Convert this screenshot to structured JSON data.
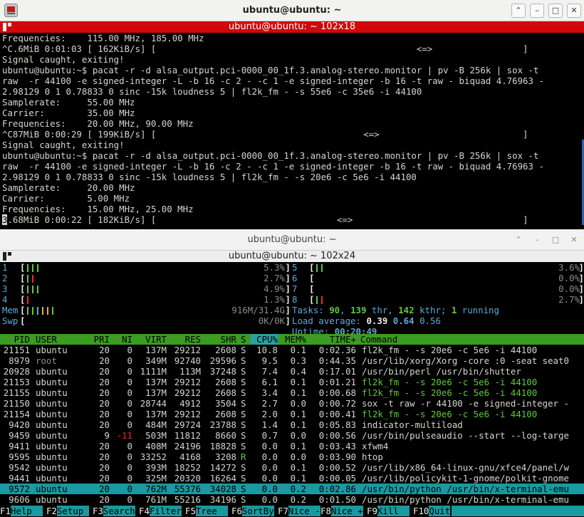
{
  "window1": {
    "title": "ubuntu@ubuntu: ~",
    "tab_title": "ubuntu@ubuntu: ~ 102x18",
    "buttons": {
      "up": "⌃",
      "minimize": "–",
      "maximize": "□",
      "close": "✕"
    },
    "lines": [
      "Frequencies:    115.00 MHz, 185.00 MHz",
      "^C.6MiB 0:01:03 [ 162KiB/s] [                                                 <=>                 ]",
      "Signal caught, exiting!",
      "ubuntu@ubuntu:~$ pacat -r -d alsa_output.pci-0000_00_1f.3.analog-stereo.monitor | pv -B 256k | sox -t",
      "raw  -r 44100 -e signed-integer -L -b 16 -c 2 - -c 1 -e signed-integer -b 16 -t raw - biquad 4.76963 -",
      "2.98129 0 1 0.78833 0 sinc -15k loudness 5 | fl2k_fm - -s 55e6 -c 35e6 -i 44100",
      "Samplerate:     55.00 MHz",
      "Carrier:        35.00 MHz",
      "Frequencies:    20.00 MHz, 90.00 MHz",
      "^C87MiB 0:00:29 [ 199KiB/s] [                                       <=>                           ]",
      "Signal caught, exiting!",
      "ubuntu@ubuntu:~$ pacat -r -d alsa_output.pci-0000_00_1f.3.analog-stereo.monitor | pv -B 256k | sox -t",
      "raw  -r 44100 -e signed-integer -L -b 16 -c 2 - -c 1 -e signed-integer -b 16 -t raw - biquad 4.76963 -",
      "2.98129 0 1 0.78833 0 sinc -15k loudness 5 | fl2k_fm - -s 20e6 -c 5e6 -i 44100",
      "Samplerate:     20.00 MHz",
      "Carrier:        5.00 MHz",
      "Frequencies:    15.00 MHz, 25.00 MHz"
    ],
    "last_line_cursor": "3",
    "last_line_rest": ".68MiB 0:00:22 [ 182KiB/s] [                                  <=>                                ]"
  },
  "window2": {
    "title": "ubuntu@ubuntu: ~",
    "tab_title": "ubuntu@ubuntu: ~ 102x24",
    "buttons": {
      "up": "⌃",
      "minimize": "–",
      "maximize": "□",
      "close": "✕"
    },
    "cpus_left": [
      {
        "label": "1",
        "value": "5.3%",
        "fill": 0.053
      },
      {
        "label": "2",
        "value": "2.7%",
        "fill": 0.027
      },
      {
        "label": "3",
        "value": "4.9%",
        "fill": 0.049
      },
      {
        "label": "4",
        "value": "1.3%",
        "fill": 0.013
      }
    ],
    "mem": {
      "label": "Mem",
      "value": "916M/31.4G"
    },
    "swp": {
      "label": "Swp",
      "value": "0K/0K"
    },
    "cpus_right": [
      {
        "label": "5",
        "value": "3.6%",
        "fill": 0.036
      },
      {
        "label": "6",
        "value": "0.0%",
        "fill": 0.0
      },
      {
        "label": "7",
        "value": "0.0%",
        "fill": 0.0
      },
      {
        "label": "8",
        "value": "2.7%",
        "fill": 0.027
      }
    ],
    "tasks": {
      "label": "Tasks: ",
      "count": "90",
      "sep1": ", ",
      "threads": "139",
      "thr_label": " thr, ",
      "kthreads": "142",
      "kthr_label": " kthr; ",
      "running": "1",
      "running_label": " running"
    },
    "load": {
      "label": "Load average: ",
      "l1": "0.39",
      "l5": "0.64",
      "l15": "0.56"
    },
    "uptime": {
      "label": "Uptime: ",
      "value": "00:20:49"
    },
    "columns": {
      "pid": "PID",
      "user": "USER",
      "pri": "PRI",
      "ni": "NI",
      "virt": "VIRT",
      "res": "RES",
      "shr": "SHR",
      "s": "S",
      "cpu": "CPU%",
      "mem": "MEM%",
      "time": "TIME+",
      "cmd": "Command"
    },
    "processes": [
      {
        "pid": "21151",
        "user": "ubuntu",
        "pri": "20",
        "ni": "0",
        "virt": "137M",
        "res": "29212",
        "shr": "2608",
        "s": "S",
        "cpu": "10.8",
        "mem": "0.1",
        "time": "0:02.36",
        "cmd": "fl2k_fm - -s 20e6 -c 5e6 -i 44100",
        "style": ""
      },
      {
        "pid": "8979",
        "user": "root",
        "pri": "20",
        "ni": "0",
        "virt": "349M",
        "res": "92740",
        "shr": "29596",
        "s": "S",
        "cpu": "9.5",
        "mem": "0.3",
        "time": "0:44.35",
        "cmd": "/usr/lib/xorg/Xorg -core :0 -seat seat0",
        "style": "root"
      },
      {
        "pid": "20928",
        "user": "ubuntu",
        "pri": "20",
        "ni": "0",
        "virt": "1111M",
        "res": "113M",
        "shr": "37248",
        "s": "S",
        "cpu": "7.4",
        "mem": "0.4",
        "time": "0:17.01",
        "cmd": "/usr/bin/perl /usr/bin/shutter",
        "style": ""
      },
      {
        "pid": "21153",
        "user": "ubuntu",
        "pri": "20",
        "ni": "0",
        "virt": "137M",
        "res": "29212",
        "shr": "2608",
        "s": "S",
        "cpu": "6.1",
        "mem": "0.1",
        "time": "0:01.21",
        "cmd": "fl2k_fm - -s 20e6 -c 5e6 -i 44100",
        "style": "thread"
      },
      {
        "pid": "21155",
        "user": "ubuntu",
        "pri": "20",
        "ni": "0",
        "virt": "137M",
        "res": "29212",
        "shr": "2608",
        "s": "S",
        "cpu": "3.4",
        "mem": "0.1",
        "time": "0:00.68",
        "cmd": "fl2k_fm - -s 20e6 -c 5e6 -i 44100",
        "style": "thread"
      },
      {
        "pid": "21150",
        "user": "ubuntu",
        "pri": "20",
        "ni": "0",
        "virt": "28744",
        "res": "4912",
        "shr": "3504",
        "s": "S",
        "cpu": "2.7",
        "mem": "0.0",
        "time": "0:00.72",
        "cmd": "sox -t raw -r 44100 -e signed-integer -",
        "style": ""
      },
      {
        "pid": "21154",
        "user": "ubuntu",
        "pri": "20",
        "ni": "0",
        "virt": "137M",
        "res": "29212",
        "shr": "2608",
        "s": "S",
        "cpu": "2.0",
        "mem": "0.1",
        "time": "0:00.41",
        "cmd": "fl2k_fm - -s 20e6 -c 5e6 -i 44100",
        "style": "thread"
      },
      {
        "pid": "9420",
        "user": "ubuntu",
        "pri": "20",
        "ni": "0",
        "virt": "484M",
        "res": "29724",
        "shr": "23788",
        "s": "S",
        "cpu": "1.4",
        "mem": "0.1",
        "time": "0:05.83",
        "cmd": "indicator-multiload",
        "style": ""
      },
      {
        "pid": "9459",
        "user": "ubuntu",
        "pri": "9",
        "ni": "-11",
        "virt": "503M",
        "res": "11812",
        "shr": "8660",
        "s": "S",
        "cpu": "0.7",
        "mem": "0.0",
        "time": "0:00.56",
        "cmd": "/usr/bin/pulseaudio --start --log-targe",
        "style": "nice"
      },
      {
        "pid": "9411",
        "user": "ubuntu",
        "pri": "20",
        "ni": "0",
        "virt": "408M",
        "res": "24196",
        "shr": "18828",
        "s": "S",
        "cpu": "0.0",
        "mem": "0.1",
        "time": "0:03.43",
        "cmd": "xfwm4",
        "style": ""
      },
      {
        "pid": "9595",
        "user": "ubuntu",
        "pri": "20",
        "ni": "0",
        "virt": "33252",
        "res": "4168",
        "shr": "3208",
        "s": "R",
        "cpu": "0.0",
        "mem": "0.0",
        "time": "0:03.90",
        "cmd": "htop",
        "style": "running"
      },
      {
        "pid": "9542",
        "user": "ubuntu",
        "pri": "20",
        "ni": "0",
        "virt": "393M",
        "res": "18252",
        "shr": "14272",
        "s": "S",
        "cpu": "0.0",
        "mem": "0.1",
        "time": "0:00.52",
        "cmd": "/usr/lib/x86_64-linux-gnu/xfce4/panel/w",
        "style": ""
      },
      {
        "pid": "9441",
        "user": "ubuntu",
        "pri": "20",
        "ni": "0",
        "virt": "325M",
        "res": "20320",
        "shr": "16264",
        "s": "S",
        "cpu": "0.0",
        "mem": "0.1",
        "time": "0:00.05",
        "cmd": "/usr/lib/policykit-1-gnome/polkit-gnome",
        "style": ""
      },
      {
        "pid": "9572",
        "user": "ubuntu",
        "pri": "20",
        "ni": "0",
        "virt": "762M",
        "res": "55376",
        "shr": "34028",
        "s": "S",
        "cpu": "0.0",
        "mem": "0.2",
        "time": "0:02.86",
        "cmd": "/usr/bin/python /usr/bin/x-terminal-emu",
        "style": "selected"
      },
      {
        "pid": "9606",
        "user": "ubuntu",
        "pri": "20",
        "ni": "0",
        "virt": "761M",
        "res": "55216",
        "shr": "34196",
        "s": "S",
        "cpu": "0.0",
        "mem": "0.2",
        "time": "0:01.50",
        "cmd": "/usr/bin/python /usr/bin/x-terminal-emu",
        "style": ""
      }
    ],
    "fkeys": [
      {
        "key": "F1",
        "label": "Help  "
      },
      {
        "key": "F2",
        "label": "Setup "
      },
      {
        "key": "F3",
        "label": "Search"
      },
      {
        "key": "F4",
        "label": "Filter"
      },
      {
        "key": "F5",
        "label": "Tree  "
      },
      {
        "key": "F6",
        "label": "SortBy"
      },
      {
        "key": "F7",
        "label": "Nice -"
      },
      {
        "key": "F8",
        "label": "Nice +"
      },
      {
        "key": "F9",
        "label": "Kill  "
      },
      {
        "key": "F10",
        "label": "Quit"
      }
    ],
    "colors": {
      "header_bg": "#3b9b22",
      "selected_bg": "#189aa0",
      "accent_blue": "#5fa9d8",
      "green": "#5ec93c",
      "red": "#ef2929"
    }
  }
}
